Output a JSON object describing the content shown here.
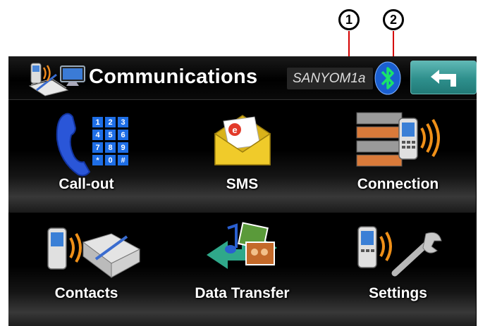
{
  "callouts": [
    {
      "number": "1",
      "target": "device-name"
    },
    {
      "number": "2",
      "target": "bluetooth-status"
    }
  ],
  "header": {
    "title": "Communications",
    "device_name": "SANYOM1a",
    "app_icon": "communications-icon",
    "bluetooth_icon": "bluetooth-icon",
    "back_icon": "back-arrow-icon"
  },
  "tiles": [
    {
      "label": "Call-out",
      "icon": "phone-keypad-icon"
    },
    {
      "label": "SMS",
      "icon": "envelope-icon"
    },
    {
      "label": "Connection",
      "icon": "connection-icon"
    },
    {
      "label": "Contacts",
      "icon": "contacts-book-icon"
    },
    {
      "label": "Data Transfer",
      "icon": "data-transfer-icon"
    },
    {
      "label": "Settings",
      "icon": "settings-wrench-icon"
    }
  ],
  "keypad_keys": [
    "1",
    "2",
    "3",
    "4",
    "5",
    "6",
    "7",
    "8",
    "9",
    "*",
    "0",
    "#"
  ],
  "colors": {
    "accent_teal": "#2e8f8c",
    "bluetooth_blue": "#1a5fd0",
    "bluetooth_green": "#19e36a",
    "callout_line": "#d40000"
  }
}
